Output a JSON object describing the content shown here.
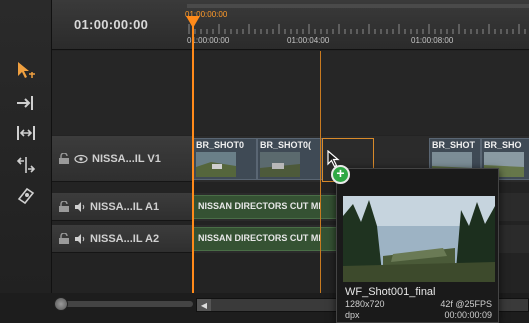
{
  "header": {
    "timecode": "01:00:00:00",
    "playhead_timecode": "01:00:00:00",
    "ruler_labels": [
      "01:00:00:00",
      "01:00:04:00",
      "01:00:08:00"
    ]
  },
  "tools": [
    "select-tool",
    "insert-edit-tool",
    "ripple-tool",
    "trim-tool",
    "slip-tool"
  ],
  "tracks": {
    "video": {
      "name": "NISSA...IL V1",
      "clips": [
        "BR_SHOT0",
        "BR_SHOT0(",
        "BR_SHOT",
        "BR_SHO"
      ]
    },
    "audio1": {
      "name": "NISSA...IL A1",
      "clip": "NISSAN DIRECTORS CUT MI"
    },
    "audio2": {
      "name": "NISSA...IL A2",
      "clip": "NISSAN DIRECTORS CUT MI"
    }
  },
  "hover_card": {
    "title": "WF_Shot001_final",
    "resolution": "1280x720",
    "fps": "42f @25FPS",
    "codec": "dpx",
    "duration": "00:00:00:09"
  },
  "colors": {
    "playhead": "#ff8a1a",
    "add_badge": "#2fa845",
    "tool_accent": "#f0a040"
  }
}
